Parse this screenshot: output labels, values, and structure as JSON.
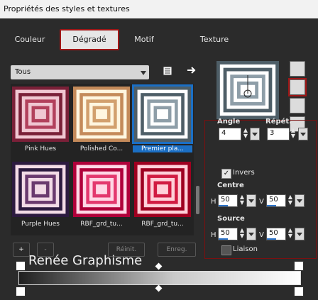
{
  "window": {
    "title": "Propriétés des styles et textures"
  },
  "tabs": [
    {
      "label": "Couleur",
      "active": false
    },
    {
      "label": "Dégradé",
      "active": true
    },
    {
      "label": "Motif",
      "active": false
    },
    {
      "label": "Texture",
      "active": false
    }
  ],
  "category": {
    "selected": "Tous"
  },
  "gradients": [
    {
      "name": "Pink Hues",
      "selected": false,
      "colors": [
        "#7a2038",
        "#f0c7d2",
        "#b2415c"
      ]
    },
    {
      "name": "Polished Co...",
      "selected": false,
      "colors": [
        "#c48a5a",
        "#fff6e0",
        "#d2a06e"
      ]
    },
    {
      "name": "Premier pla...",
      "selected": true,
      "colors": [
        "#4e5e67",
        "#ffffff",
        "#8e9ea8"
      ]
    },
    {
      "name": "Purple Hues",
      "selected": false,
      "colors": [
        "#2c1a3f",
        "#f2dbe6",
        "#6a3a6e"
      ]
    },
    {
      "name": "RBF_grd_tu...",
      "selected": false,
      "colors": [
        "#b0003a",
        "#ffd7e6",
        "#e3386e"
      ]
    },
    {
      "name": "RBF_grd_tu...",
      "selected": false,
      "colors": [
        "#9e0020",
        "#ffd0d9",
        "#d11b42"
      ]
    }
  ],
  "buttons": {
    "add": "+",
    "remove": "-",
    "reset": "Réinit.",
    "save": "Enreg."
  },
  "settings": {
    "angle_label": "Angle",
    "angle": "4",
    "repeat_label": "Répét.",
    "repeat": "3",
    "invert_label": "Invers",
    "invert": true,
    "center_label": "Centre",
    "center_h_label": "H",
    "center_h": "50",
    "center_v_label": "V",
    "center_v": "50",
    "source_label": "Source",
    "source_h_label": "H",
    "source_h": "50",
    "source_v_label": "V",
    "source_v": "50",
    "link_label": "Liaison",
    "link": false
  },
  "watermark": "Renée Graphisme",
  "colors": {
    "accent": "#1b6fc4",
    "highlight_border": "#a01616"
  }
}
